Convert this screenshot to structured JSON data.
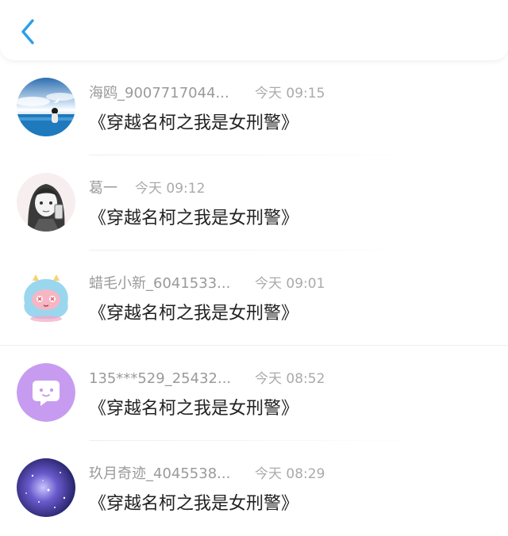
{
  "header": {
    "back_icon": "chevron-left-icon",
    "accent": "#2aa0e8"
  },
  "items": [
    {
      "name": "海鸥_9007717044...",
      "time": "今天 09:15",
      "content": "《穿越名柯之我是女刑警》",
      "avatar": "avatar-ocean"
    },
    {
      "name": "葛一",
      "time": "今天 09:12",
      "content": "《穿越名柯之我是女刑警》",
      "avatar": "avatar-sketch-girl"
    },
    {
      "name": "蜡毛小新_6041533...",
      "time": "今天 09:01",
      "content": "《穿越名柯之我是女刑警》",
      "avatar": "avatar-cute-monster"
    },
    {
      "name": "135***529_25432...",
      "time": "今天 08:52",
      "content": "《穿越名柯之我是女刑警》",
      "avatar": "avatar-chat-bubble"
    },
    {
      "name": "玖月奇迹_4045538...",
      "time": "今天 08:29",
      "content": "《穿越名柯之我是女刑警》",
      "avatar": "avatar-galaxy"
    }
  ]
}
